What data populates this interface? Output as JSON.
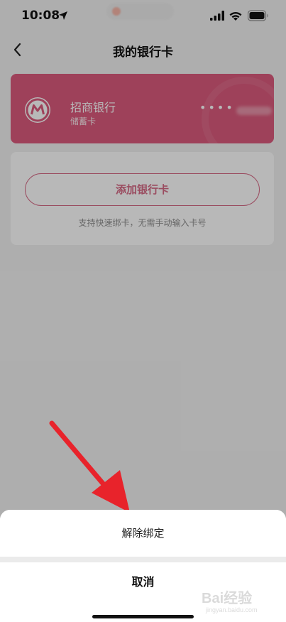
{
  "status_bar": {
    "time": "10:08"
  },
  "nav": {
    "title": "我的银行卡"
  },
  "card": {
    "bank_name": "招商银行",
    "card_type": "储蓄卡",
    "masked": "••••",
    "color": "#dc5b7d"
  },
  "add_panel": {
    "button_label": "添加银行卡",
    "hint": "支持快速绑卡，无需手动输入卡号",
    "accent_color": "#d66a86"
  },
  "action_sheet": {
    "unbind_label": "解除绑定",
    "cancel_label": "取消"
  },
  "watermark": {
    "main": "Bai经验",
    "sub": "jingyan.baidu.com"
  },
  "annotation": {
    "arrow_color": "#e8232b"
  }
}
